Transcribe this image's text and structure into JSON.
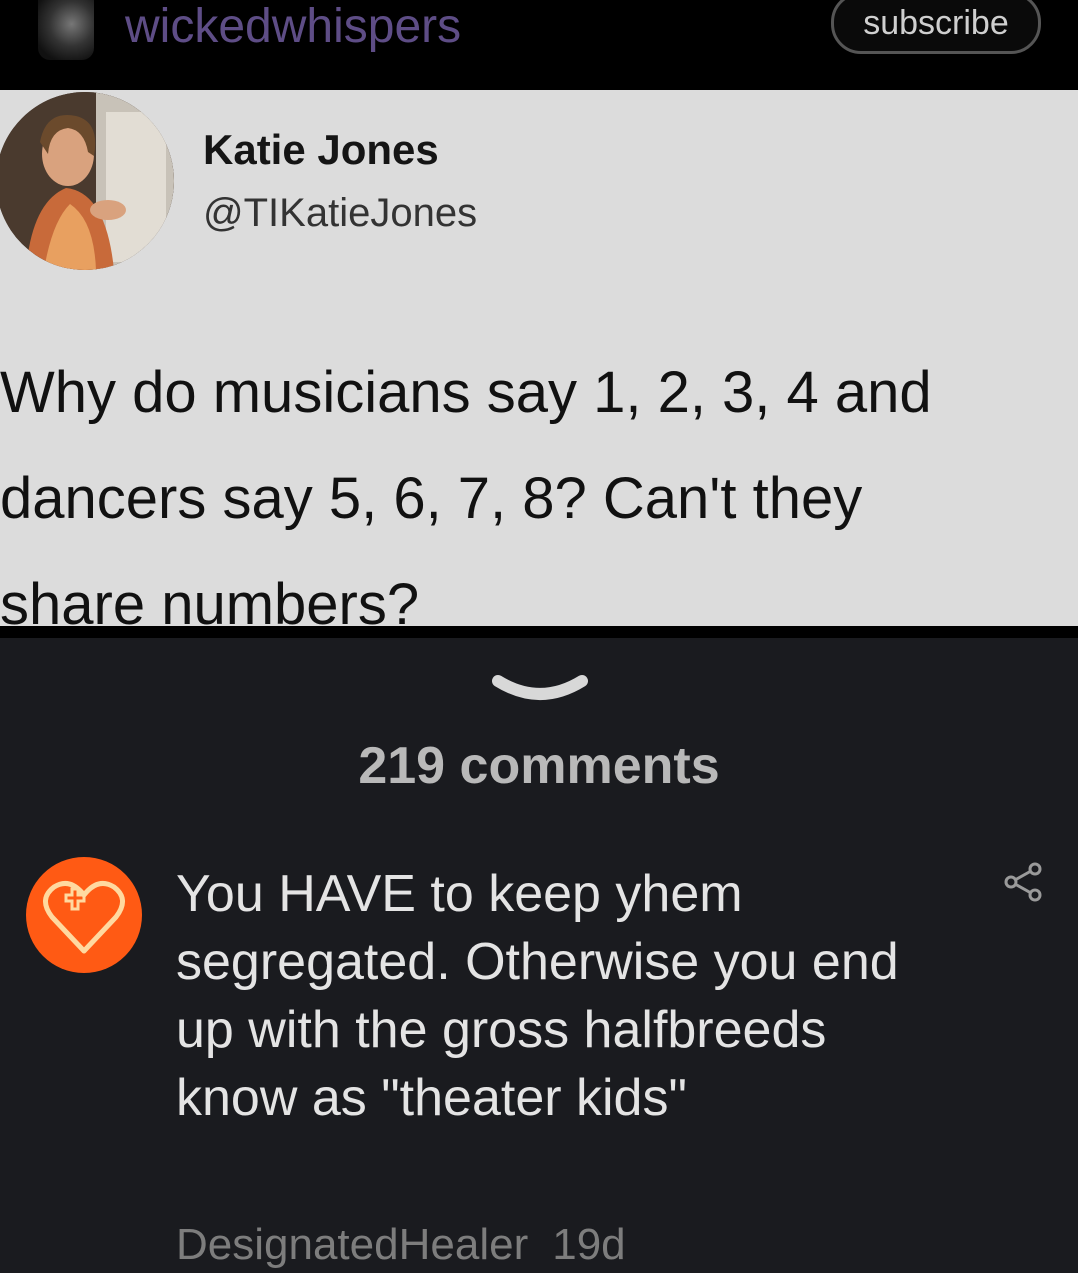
{
  "header": {
    "username": "wickedwhispers",
    "subscribe_label": "subscribe"
  },
  "tweet": {
    "name": "Katie Jones",
    "handle": "@TIKatieJones",
    "text": "Why do musicians say 1, 2, 3, 4 and\ndancers say 5, 6, 7, 8? Can't they\nshare numbers?"
  },
  "comments": {
    "count_label": "219 comments",
    "items": [
      {
        "text": "You HAVE to keep yhem segregated. Otherwise you end up with the gross halfbreeds know as \"theater kids\"",
        "author": "DesignatedHealer",
        "time": "19d"
      }
    ]
  },
  "icons": {
    "collapse": "chevron-down-icon",
    "share": "share-icon",
    "comment_avatar": "heart-icon"
  },
  "colors": {
    "username": "#5e4d86",
    "tweet_bg": "#dcdcdc",
    "panel_bg": "#1a1b1f",
    "avatar_orange": "#ff5a14"
  }
}
